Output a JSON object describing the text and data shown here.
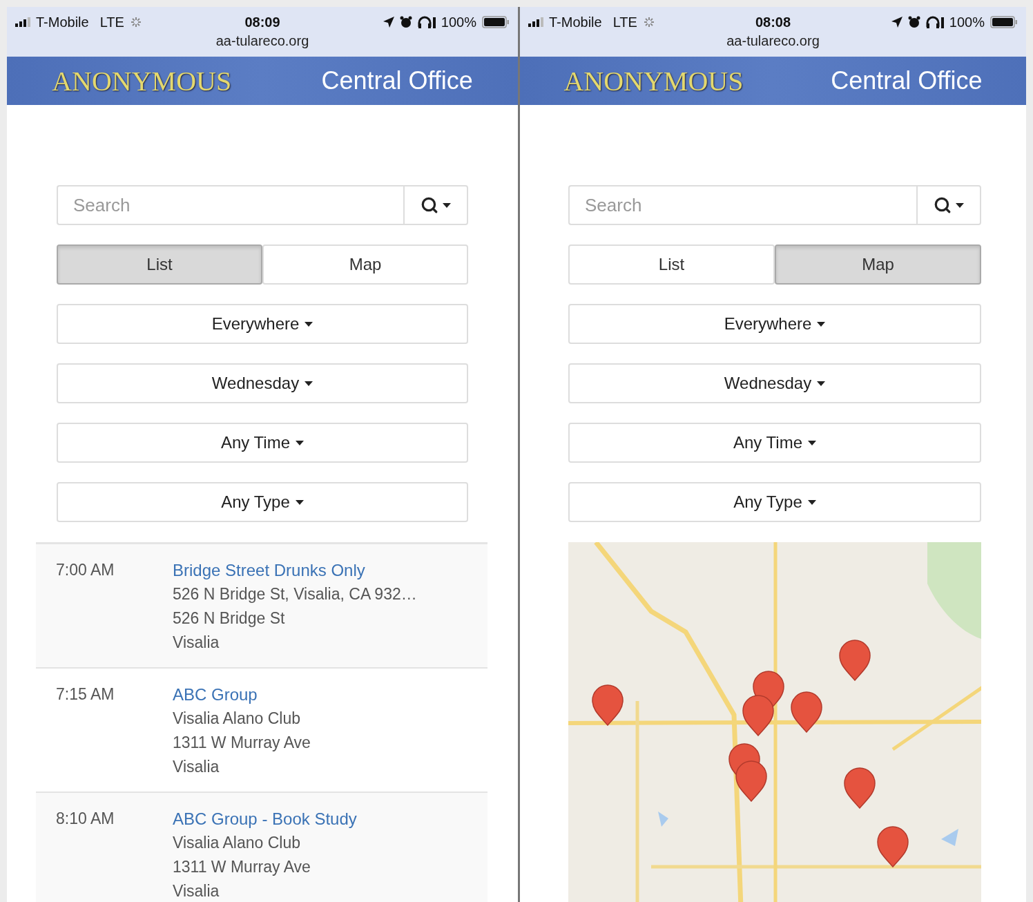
{
  "phones": [
    {
      "status_bar": {
        "carrier": "T-Mobile",
        "network": "LTE",
        "time": "08:09",
        "battery": "100%"
      },
      "url": "aa-tulareco.org",
      "header": {
        "logo": "ANONYMOUS",
        "title": "Central Office"
      },
      "search": {
        "placeholder": "Search"
      },
      "view_toggle": [
        {
          "label": "List",
          "selected": true
        },
        {
          "label": "Map",
          "selected": false
        }
      ],
      "filters": [
        "Everywhere",
        "Wednesday",
        "Any Time",
        "Any Type"
      ],
      "content": {
        "kind": "list",
        "meetings": [
          {
            "time": "7:00 AM",
            "name": "Bridge Street Drunks Only",
            "lines": [
              "526 N Bridge St, Visalia, CA 932…",
              "526 N Bridge St",
              "Visalia"
            ]
          },
          {
            "time": "7:15 AM",
            "name": "ABC Group",
            "lines": [
              "Visalia Alano Club",
              "1311 W Murray Ave",
              "Visalia"
            ]
          },
          {
            "time": "8:10 AM",
            "name": "ABC Group - Book Study",
            "lines": [
              "Visalia Alano Club",
              "1311 W Murray Ave",
              "Visalia"
            ]
          }
        ]
      }
    },
    {
      "status_bar": {
        "carrier": "T-Mobile",
        "network": "LTE",
        "time": "08:08",
        "battery": "100%"
      },
      "url": "aa-tulareco.org",
      "header": {
        "logo": "ANONYMOUS",
        "title": "Central Office"
      },
      "search": {
        "placeholder": "Search"
      },
      "view_toggle": [
        {
          "label": "List",
          "selected": false
        },
        {
          "label": "Map",
          "selected": true
        }
      ],
      "filters": [
        "Everywhere",
        "Wednesday",
        "Any Time",
        "Any Type"
      ],
      "content": {
        "kind": "map"
      }
    }
  ]
}
